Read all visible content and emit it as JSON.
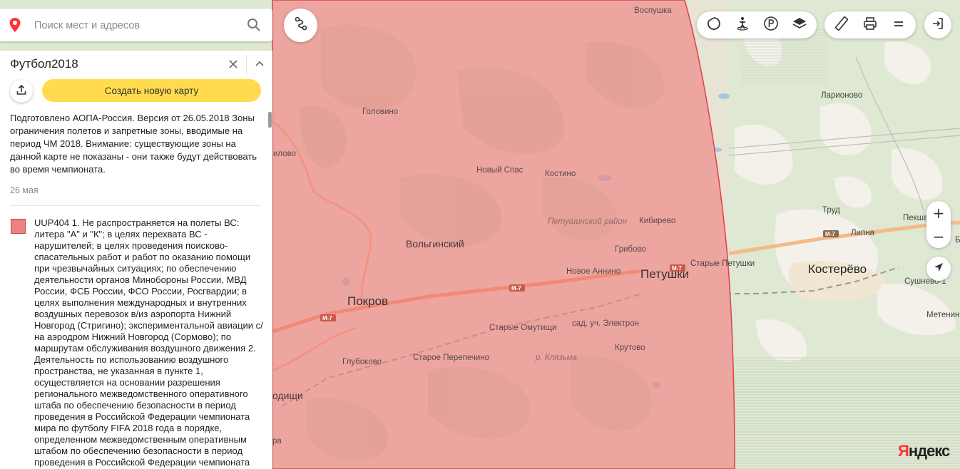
{
  "search": {
    "placeholder": "Поиск мест и адресов"
  },
  "panel": {
    "title": "Футбол2018",
    "create_button": "Создать новую карту",
    "description": "Подготовлено АОПА-Россия. Версия от 26.05.2018 Зоны ограничения полетов и запретные зоны, вводимые на период ЧМ 2018. Внимание: существующие зоны на данной карте не показаны - они также будут действовать во время чемпионата.",
    "date": "26 мая",
    "item": {
      "swatch_color": "#f08080",
      "text": "UUP404 1. Не распространяется на полеты ВС: литера \"А\" и \"К\"; в целях перехвата ВС - нарушителей; в целях проведения поисково-спасательных работ и работ по оказанию помощи при чрезвычайных ситуациях; по обеспечению деятельности органов Минобороны России, МВД России, ФСБ России, ФСО России, Росгвардии; в целях выполнения международных и внутренних воздушных перевозок в/из аэропорта Нижний Новгород (Стригино); экспериментальной авиации с/на аэродром Нижний Новгород (Сормово); по маршрутам обслуживания воздушного движения 2. Деятельность по использованию воздушного пространства, не указанная в пункте 1, осуществляется на основании разрешения регионального межведомственного оперативного штаба по обеспечению безопасности в период проведения в Российской Федерации чемпионата мира по футболу FIFA 2018 года в порядке, определенном межведомственным оперативным штабом по обеспечению безопасности в период проведения в Российской Федерации чемпионата"
    }
  },
  "map": {
    "zone_color": "#f08080",
    "labels": {
      "voshushka": "Воспушка",
      "golovino": "Головино",
      "ilovo": "илово",
      "novy_spas": "Новый Спас",
      "kostino": "Костино",
      "district": "Петушинский район",
      "kibirevo": "Кибирево",
      "volginsky": "Вольгинский",
      "gribovo": "Грибово",
      "novoe_annino": "Новое Аннино",
      "petushki": "Петушки",
      "starye_petushki": "Старые Петушки",
      "pokrov": "Покров",
      "starye_omutishchi": "Старые Омутищи",
      "elektron": "сад. уч. Электрон",
      "krutovo": "Крутово",
      "staroe_perepechino": "Старое Перепечино",
      "glubokovo": "Глубоково",
      "klyazma": "р. Клязьма",
      "roditsy": "одищи",
      "ra": "ра",
      "larionovo": "Ларионово",
      "trud": "Труд",
      "peksha": "Пекша",
      "lipna": "Липна",
      "kosterevo": "Костерёво",
      "sushnevo": "Сушнево-1",
      "metenino": "Метенин",
      "b": "Б"
    },
    "road_shields": [
      "M-7",
      "M-7",
      "M-7",
      "M-7"
    ]
  },
  "zoom": {
    "plus": "+",
    "minus": "−"
  },
  "logo": {
    "first": "Я",
    "rest": "ндекс"
  }
}
